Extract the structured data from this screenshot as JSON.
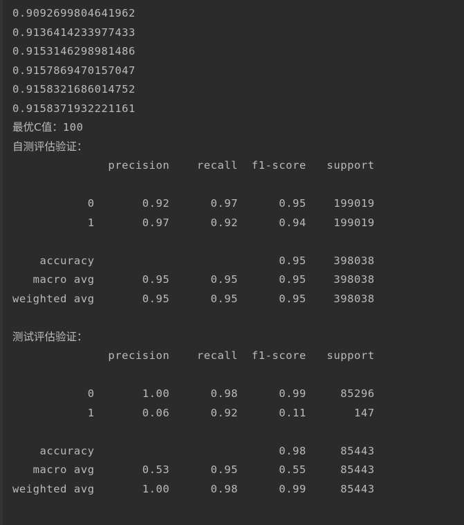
{
  "console": {
    "clipped_top_line": "",
    "iteration_scores": [
      "0.9092699804641962",
      "0.9136414233977433",
      "0.9153146298981486",
      "0.9157869470157047",
      "0.9158321686014752",
      "0.9158371932221161"
    ],
    "best_c_label": "最优C值：",
    "best_c_value": "100",
    "self_eval": {
      "title": "自测评估验证：",
      "header": "              precision    recall  f1-score   support",
      "rows": [
        "           0       0.92      0.97      0.95    199019",
        "           1       0.97      0.92      0.94    199019",
        "    accuracy                           0.95    398038",
        "   macro avg       0.95      0.95      0.95    398038",
        "weighted avg       0.95      0.95      0.95    398038"
      ]
    },
    "test_eval": {
      "title": "测试评估验证：",
      "header": "              precision    recall  f1-score   support",
      "rows": [
        "           0       1.00      0.98      0.99     85296",
        "           1       0.06      0.92      0.11       147",
        "    accuracy                           0.98     85443",
        "   macro avg       0.53      0.95      0.55     85443",
        "weighted avg       1.00      0.98      0.99     85443"
      ]
    },
    "colors": {
      "background": "#2b2b2b",
      "text": "#bbbbbb",
      "gutter": "#313335"
    }
  }
}
